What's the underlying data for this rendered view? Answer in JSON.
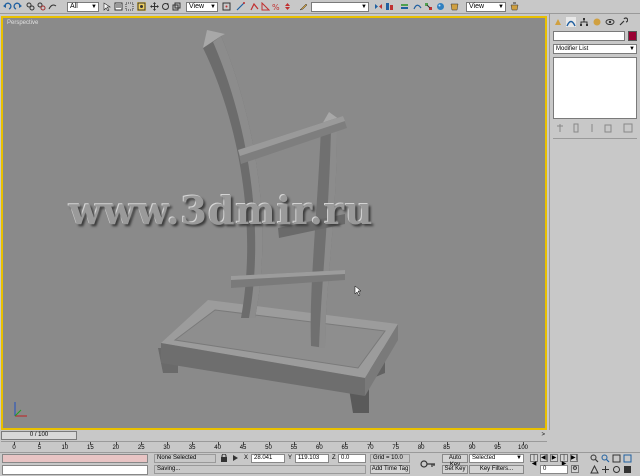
{
  "toolbar": {
    "selection_filter": "All",
    "ref_coord": "View",
    "named_selection": "",
    "render_view": "View"
  },
  "viewport": {
    "label": "Perspective",
    "watermark": "www.3dmir.ru"
  },
  "command_panel": {
    "object_name": "",
    "modifier_list": "Modifier List"
  },
  "time_slider": {
    "position": "0 / 100"
  },
  "trackbar": {
    "ticks": [
      "0",
      "5",
      "10",
      "15",
      "20",
      "25",
      "30",
      "35",
      "40",
      "45",
      "50",
      "55",
      "60",
      "65",
      "70",
      "75",
      "80",
      "85",
      "90",
      "95",
      "100"
    ]
  },
  "status": {
    "selection": "None Selected",
    "prompt": "Saving...",
    "x_label": "X",
    "x_value": "28.041",
    "y_label": "Y",
    "y_value": "119.103",
    "z_label": "Z",
    "z_value": "0.0",
    "grid": "Grid = 10.0",
    "add_time_tag": "Add Time Tag",
    "auto_key": "Auto Key",
    "set_key": "Set Key",
    "key_mode": "Selected",
    "key_filters": "Key Filters...",
    "frame": "0"
  },
  "colors": {
    "viewport_bg": "#8a8a8a",
    "active_border": "#e8c000",
    "object_color": "#990033",
    "maxscript_listener": "#e8c4c4"
  }
}
